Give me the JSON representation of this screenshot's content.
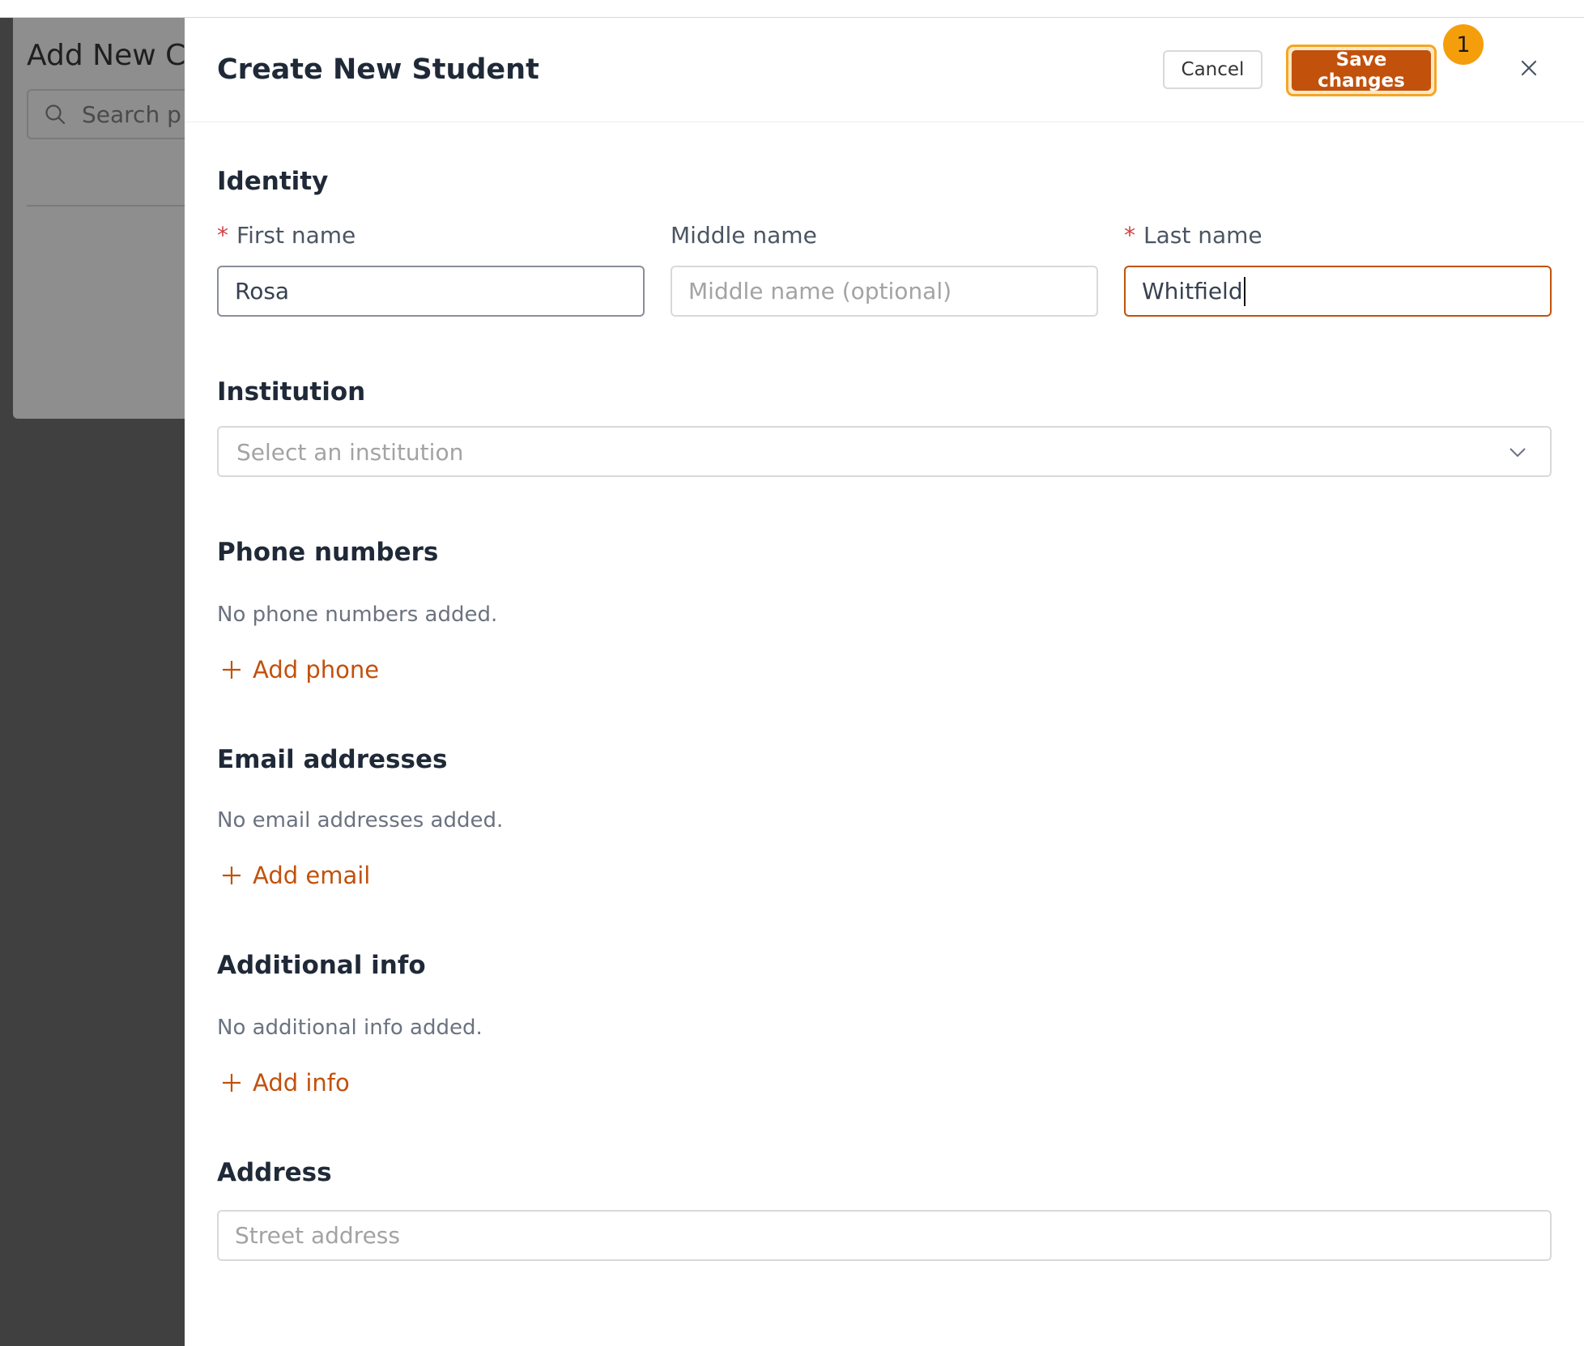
{
  "background": {
    "title": "Add New C",
    "search_placeholder": "Search p"
  },
  "drawer": {
    "title": "Create New Student",
    "cancel_label": "Cancel",
    "save_label": "Save changes",
    "badge_count": "1"
  },
  "identity": {
    "section_title": "Identity",
    "first_name": {
      "required_mark": "*",
      "label": "First name",
      "value": "Rosa"
    },
    "middle_name": {
      "label": "Middle name",
      "placeholder": "Middle name (optional)"
    },
    "last_name": {
      "required_mark": "*",
      "label": "Last name",
      "value": "Whitfield"
    }
  },
  "institution": {
    "section_title": "Institution",
    "placeholder": "Select an institution"
  },
  "phones": {
    "section_title": "Phone numbers",
    "empty_text": "No phone numbers added.",
    "add_label": "Add phone"
  },
  "emails": {
    "section_title": "Email addresses",
    "empty_text": "No email addresses added.",
    "add_label": "Add email"
  },
  "additional_info": {
    "section_title": "Additional info",
    "empty_text": "No additional info added.",
    "add_label": "Add info"
  },
  "address": {
    "section_title": "Address",
    "placeholder": "Street address"
  },
  "colors": {
    "accent": "#c2510c",
    "badge": "#f59e0b",
    "required": "#d14343"
  }
}
